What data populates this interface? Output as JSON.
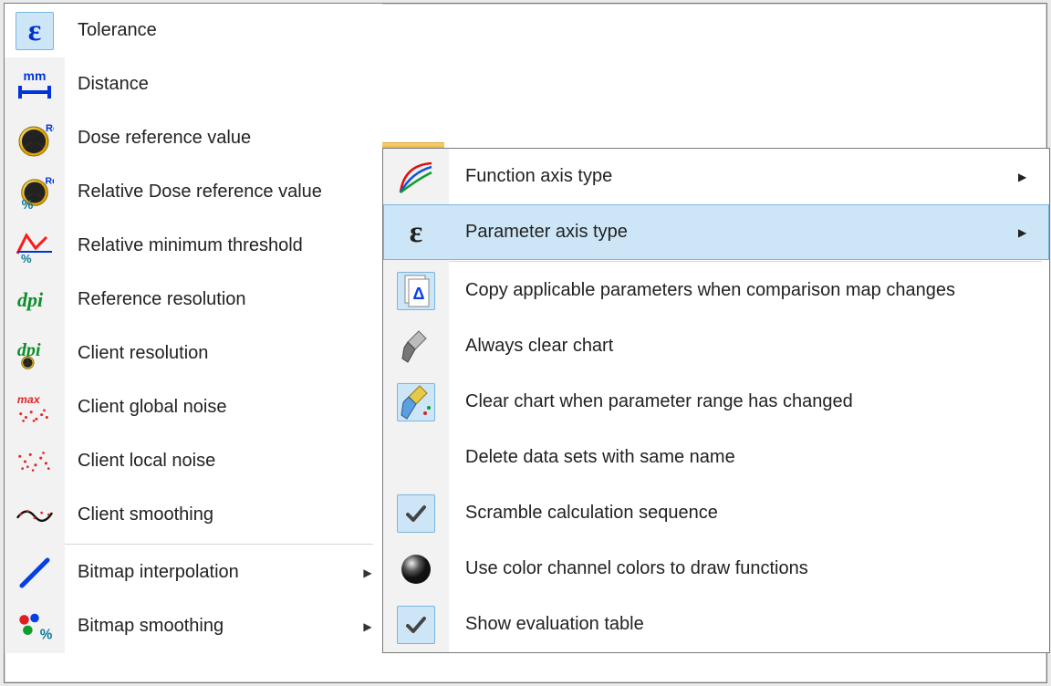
{
  "left": {
    "items": [
      {
        "label": "Tolerance",
        "icon": "epsilon-icon",
        "active": true
      },
      {
        "label": "Distance",
        "icon": "mm-distance-icon"
      },
      {
        "label": "Dose reference value",
        "icon": "radiation-ref-icon"
      },
      {
        "label": "Relative Dose reference value",
        "icon": "radiation-ref-percent-icon"
      },
      {
        "label": "Relative minimum threshold",
        "icon": "threshold-curve-icon"
      },
      {
        "label": "Reference resolution",
        "icon": "dpi-green-icon"
      },
      {
        "label": "Client resolution",
        "icon": "dpi-rad-icon"
      },
      {
        "label": "Client global noise",
        "icon": "noise-max-icon"
      },
      {
        "label": "Client local noise",
        "icon": "noise-local-icon"
      },
      {
        "label": "Client smoothing",
        "icon": "smoothing-line-icon"
      }
    ],
    "footer_items": [
      {
        "label": "Bitmap interpolation",
        "icon": "blue-line-icon",
        "submenu": true
      },
      {
        "label": "Bitmap smoothing",
        "icon": "rgb-percent-icon",
        "submenu": true
      }
    ]
  },
  "right": {
    "items": [
      {
        "label": "Function axis type",
        "icon": "function-curves-icon",
        "submenu": true
      },
      {
        "label": "Parameter axis type",
        "icon": "epsilon-icon",
        "submenu": true,
        "hover": true
      }
    ],
    "items2": [
      {
        "label": "Copy applicable parameters when comparison map changes",
        "icon": "copy-params-icon",
        "selected": true
      },
      {
        "label": "Always clear chart",
        "icon": "brush-grey-icon"
      },
      {
        "label": "Clear chart when parameter range has changed",
        "icon": "brush-color-icon",
        "selected": true
      },
      {
        "label": "Delete data sets with same name",
        "icon": "blank-icon"
      },
      {
        "label": "Scramble calculation sequence",
        "icon": "checkmark-icon",
        "selected": true
      },
      {
        "label": "Use color channel colors to draw functions",
        "icon": "sphere-icon"
      },
      {
        "label": "Show evaluation table",
        "icon": "checkmark-icon",
        "selected": true
      }
    ]
  }
}
